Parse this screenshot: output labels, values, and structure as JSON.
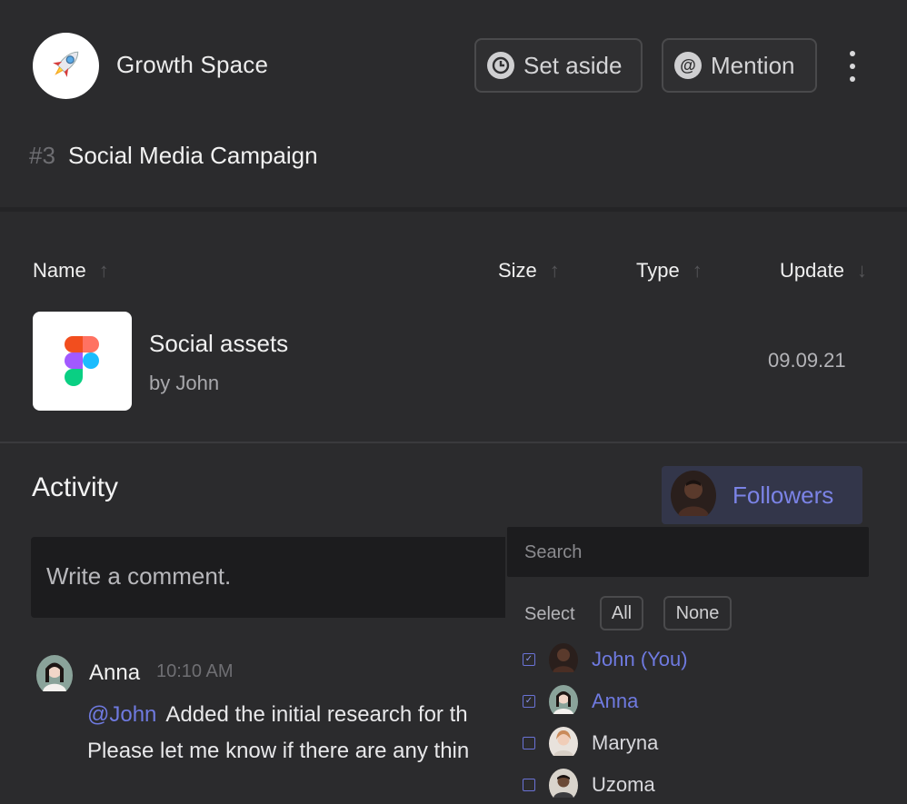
{
  "header": {
    "space_name": "Growth Space",
    "set_aside_label": "Set aside",
    "mention_label": "Mention",
    "task_id": "#3",
    "task_title": "Social Media Campaign"
  },
  "files": {
    "columns": [
      "Name",
      "Size",
      "Type",
      "Update"
    ],
    "rows": [
      {
        "name": "Social assets",
        "by": "by John",
        "update": "09.09.21"
      }
    ]
  },
  "activity": {
    "title": "Activity",
    "followers_label": "Followers",
    "comment_placeholder": "Write a comment.",
    "messages": [
      {
        "user": "Anna",
        "time": "10:10 AM",
        "mention": "@John",
        "line1": "Added the initial research for th",
        "line2": "Please let me know if there are any thin"
      }
    ]
  },
  "followers_dropdown": {
    "search_placeholder": "Search",
    "select_label": "Select",
    "all_label": "All",
    "none_label": "None",
    "people": [
      {
        "name": "John (You)",
        "checked": true
      },
      {
        "name": "Anna",
        "checked": true
      },
      {
        "name": "Maryna",
        "checked": false
      },
      {
        "name": "Uzoma",
        "checked": false
      }
    ]
  },
  "colors": {
    "background": "#2b2b2d",
    "accent": "#6f7ae0",
    "input_bg": "#1c1c1e",
    "followers_bg": "#33364a"
  }
}
